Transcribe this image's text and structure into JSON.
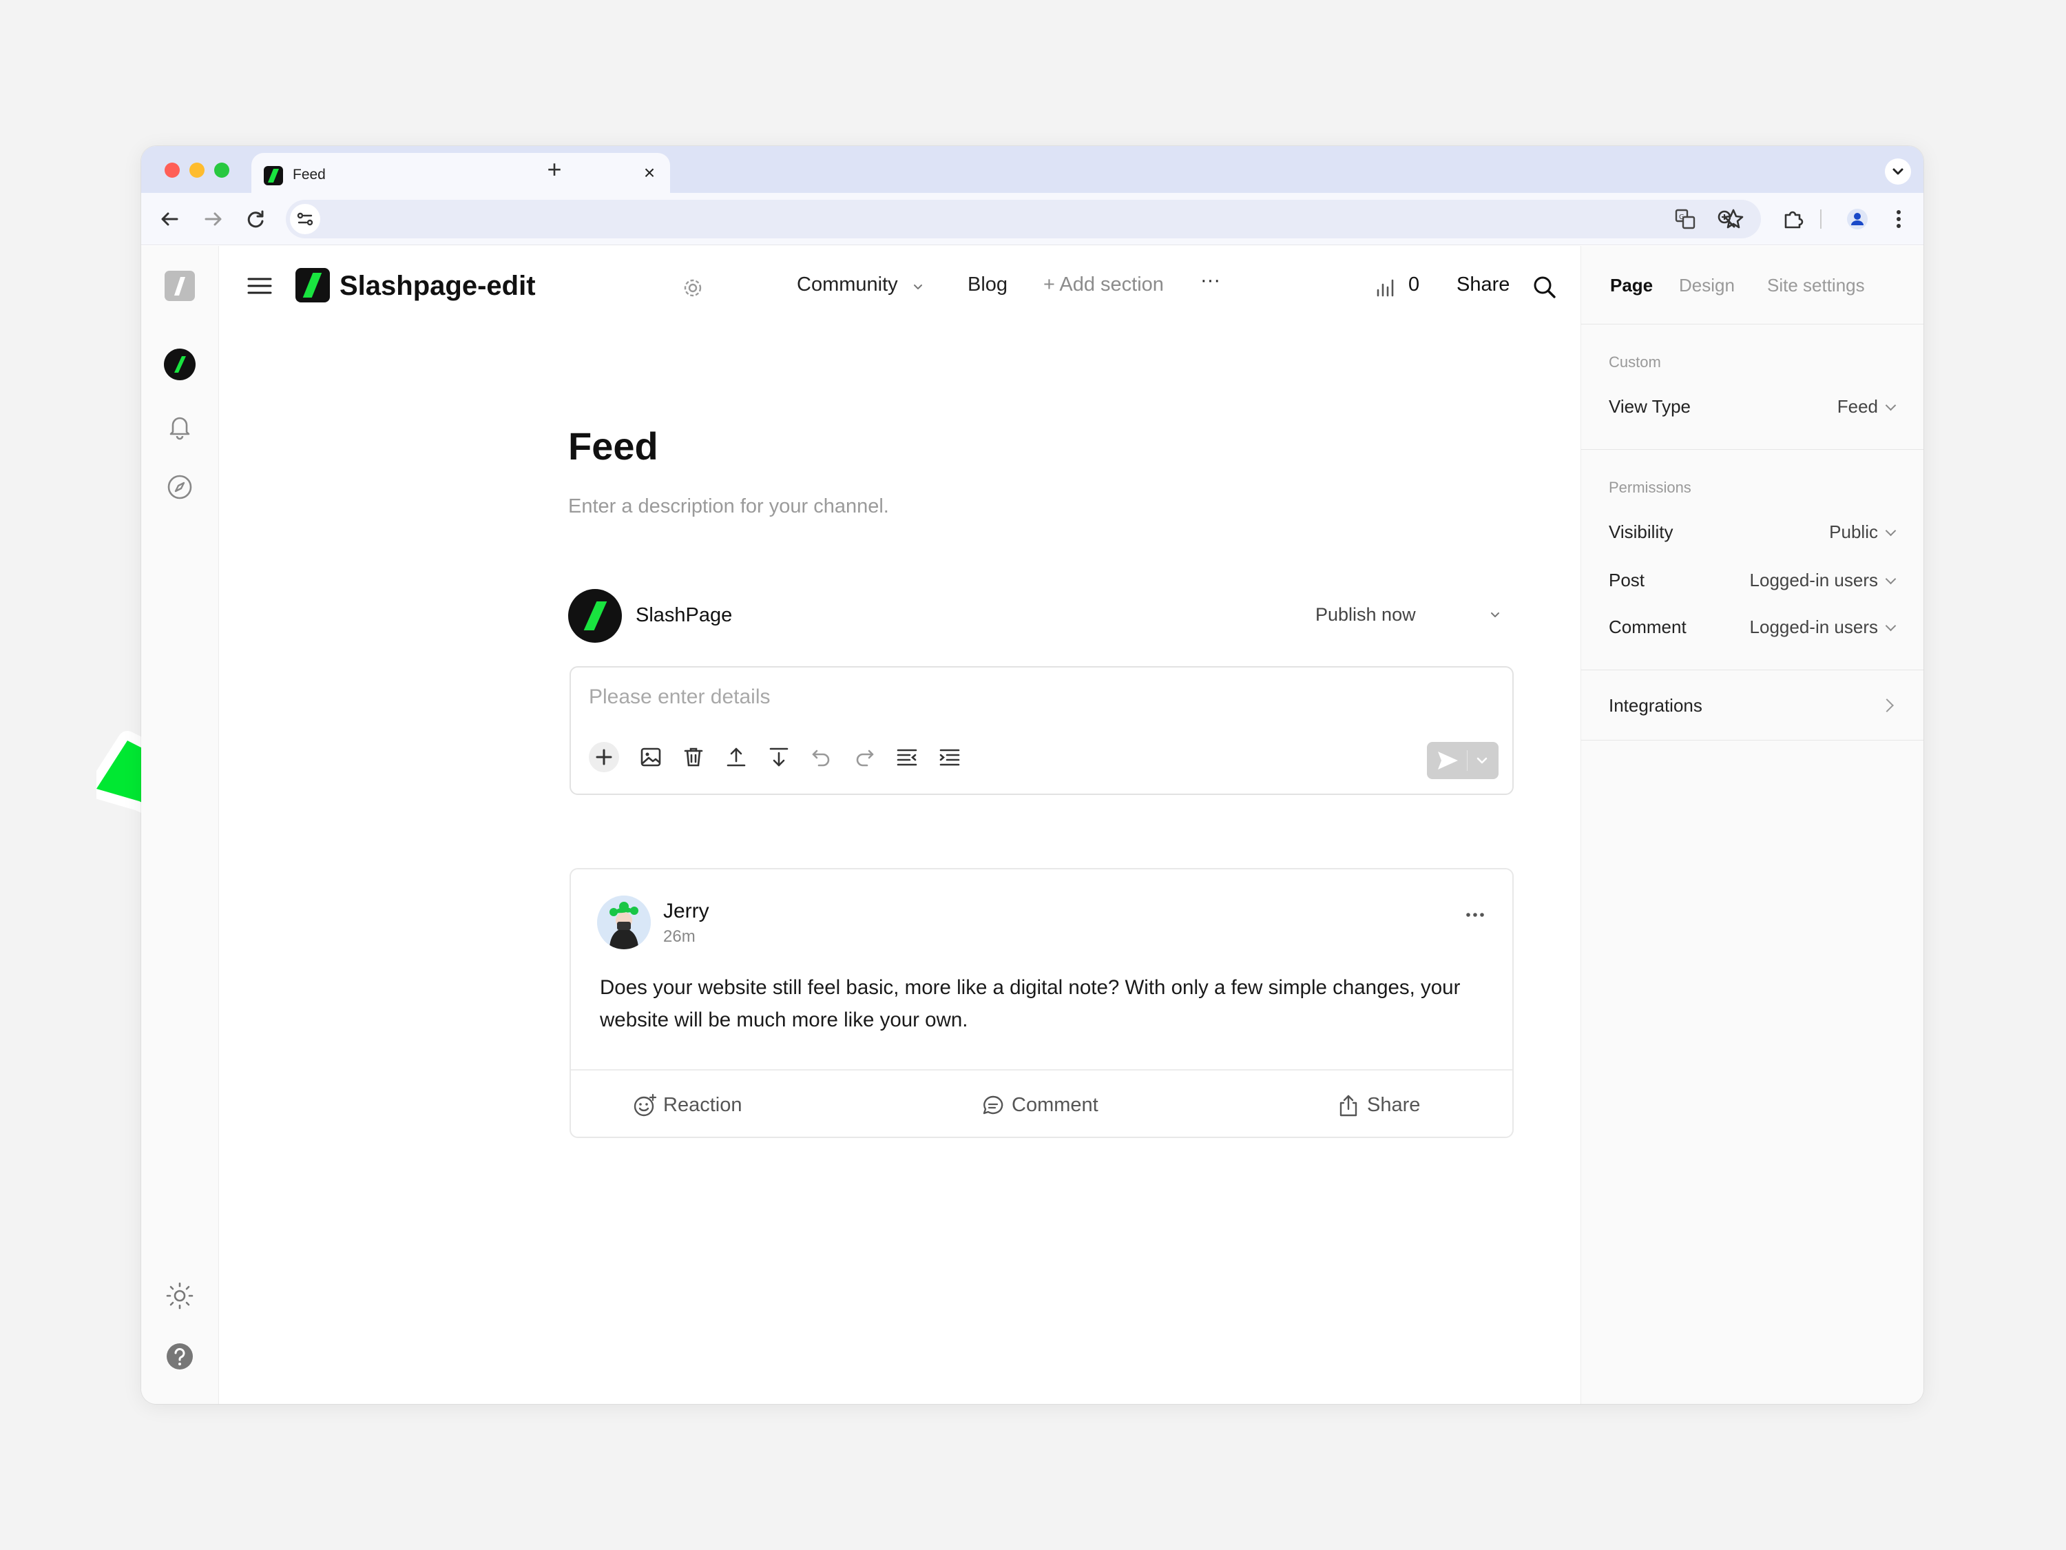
{
  "browser": {
    "tab_title": "Feed",
    "tab_close": "×",
    "new_tab": "+"
  },
  "topnav": {
    "site_name": "Slashpage-edit",
    "links": {
      "community": "Community",
      "blog": "Blog",
      "add_section": "+ Add section",
      "more": "···"
    },
    "stats_count": "0",
    "share": "Share"
  },
  "page": {
    "title": "Feed",
    "description": "Enter a description for your channel."
  },
  "composer": {
    "author": "SlashPage",
    "publish": "Publish now",
    "placeholder": "Please enter details"
  },
  "post": {
    "author": "Jerry",
    "time": "26m",
    "body": "Does your website still feel basic, more like a digital note? With only a few simple changes, your website will be much more like your own.",
    "actions": {
      "reaction": "Reaction",
      "comment": "Comment",
      "share": "Share"
    }
  },
  "right_panel": {
    "tabs": {
      "page": "Page",
      "design": "Design",
      "site_settings": "Site settings"
    },
    "custom": {
      "caption": "Custom",
      "view_type_label": "View Type",
      "view_type_value": "Feed"
    },
    "permissions": {
      "caption": "Permissions",
      "visibility_label": "Visibility",
      "visibility_value": "Public",
      "post_label": "Post",
      "post_value": "Logged-in users",
      "comment_label": "Comment",
      "comment_value": "Logged-in users"
    },
    "integrations": "Integrations"
  },
  "colors": {
    "brand_green": "#19e33f",
    "annotation_green": "#00e832",
    "dark": "#111111"
  },
  "icons": [
    "back-arrow-icon",
    "forward-arrow-icon",
    "reload-icon",
    "site-info-icon",
    "translate-icon",
    "zoom-icon",
    "star-icon",
    "extensions-icon",
    "profile-icon",
    "kebab-icon",
    "hamburger-icon",
    "gear-icon",
    "stats-bar-icon",
    "search-icon",
    "pencil-icon",
    "more-icon",
    "bell-icon",
    "compass-icon",
    "sun-icon",
    "help-icon",
    "plus-icon",
    "image-icon",
    "trash-icon",
    "upload-icon",
    "download-icon",
    "undo-icon",
    "redo-icon",
    "outdent-icon",
    "indent-icon",
    "send-icon",
    "smile-icon",
    "comment-icon",
    "share-icon"
  ]
}
